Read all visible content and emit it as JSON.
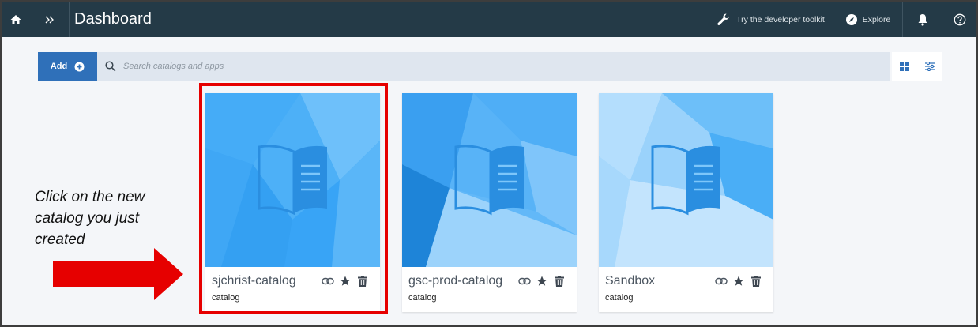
{
  "header": {
    "title": "Dashboard",
    "toolkit_label": "Try the developer toolkit",
    "explore_label": "Explore"
  },
  "toolbar": {
    "add_label": "Add",
    "search_placeholder": "Search catalogs and apps"
  },
  "cards": [
    {
      "name": "sjchrist-catalog",
      "type": "catalog"
    },
    {
      "name": "gsc-prod-catalog",
      "type": "catalog"
    },
    {
      "name": "Sandbox",
      "type": "catalog"
    }
  ],
  "annotation": {
    "text": "Click on the new catalog you just created"
  },
  "colors": {
    "topbar": "#243a47",
    "add_button": "#2f70b9",
    "highlight": "#e60000",
    "card_blue": "#3aa6f5"
  },
  "icons": [
    "home-icon",
    "double-chevron-icon",
    "wrench-icon",
    "compass-icon",
    "bell-icon",
    "help-icon",
    "add-circle-icon",
    "search-icon",
    "grid-view-icon",
    "filter-icon",
    "book-icon",
    "link-icon",
    "star-icon",
    "trash-icon",
    "arrow-right-icon"
  ]
}
